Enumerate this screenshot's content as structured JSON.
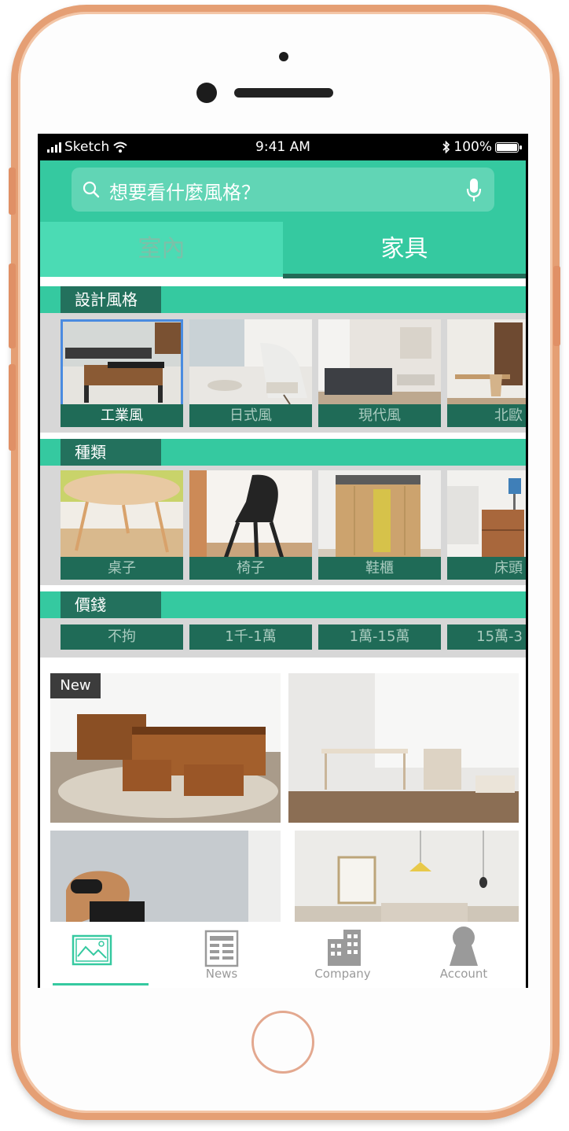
{
  "status_bar": {
    "carrier": "Sketch",
    "time": "9:41 AM",
    "battery": "100%"
  },
  "search": {
    "placeholder": "想要看什麼風格？",
    "icon": "search-icon",
    "voice_icon": "microphone-icon"
  },
  "tabs": [
    {
      "label": "室內",
      "selected": false
    },
    {
      "label": "家具",
      "selected": true
    }
  ],
  "sections": {
    "style": {
      "title": "設計風格",
      "items": [
        {
          "label": "工業風",
          "selected": true
        },
        {
          "label": "日式風",
          "selected": false
        },
        {
          "label": "現代風",
          "selected": false
        },
        {
          "label": "北歐",
          "selected": false
        }
      ]
    },
    "category": {
      "title": "種類",
      "items": [
        {
          "label": "桌子"
        },
        {
          "label": "椅子"
        },
        {
          "label": "鞋櫃"
        },
        {
          "label": "床頭"
        }
      ]
    },
    "price": {
      "title": "價錢",
      "items": [
        {
          "label": "不拘"
        },
        {
          "label": "1千-1萬"
        },
        {
          "label": "1萬-15萬"
        },
        {
          "label": "15萬-3"
        }
      ]
    }
  },
  "feed": {
    "new_badge": "New"
  },
  "tab_bar": {
    "items": [
      {
        "label": "",
        "icon": "gallery-icon",
        "active": true
      },
      {
        "label": "News",
        "icon": "news-icon",
        "active": false
      },
      {
        "label": "Company",
        "icon": "building-icon",
        "active": false
      },
      {
        "label": "Account",
        "icon": "person-icon",
        "active": false
      }
    ]
  },
  "colors": {
    "accent": "#35c9a0",
    "accent_light": "#4bdbb4",
    "label_dark": "#23715d",
    "caption_bg": "#1f6b57",
    "selection": "#4a8be0",
    "phone_frame": "#e59f74"
  }
}
